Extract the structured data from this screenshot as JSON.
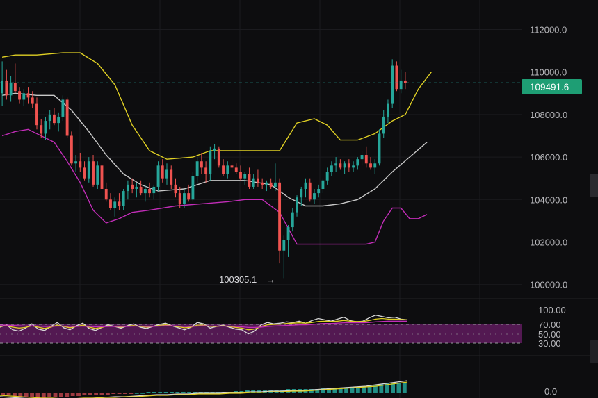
{
  "chart_data": [
    {
      "type": "line",
      "panel": "price",
      "subtype": "candlestick with Bollinger Bands",
      "y_ticks": [
        "112000.0",
        "110000.0",
        "108000.0",
        "106000.0",
        "104000.0",
        "102000.0",
        "100000.0"
      ],
      "ylim": [
        99500,
        112800
      ],
      "last_price": "109491.6",
      "low_annotation": "100305.1",
      "low_arrow": "→",
      "grid": true,
      "colors": {
        "up": "#26a69a",
        "down": "#ef5350",
        "upper_band": "#e0d024",
        "middle_band": "#c8c8c8",
        "lower_band": "#c22db8",
        "price_line": "#26a69a",
        "price_tag": "#1e9e74"
      },
      "candles": [
        [
          109000,
          110500,
          108400,
          109600
        ],
        [
          109600,
          110100,
          108700,
          108900
        ],
        [
          108900,
          109800,
          108600,
          109500
        ],
        [
          109500,
          110400,
          109000,
          109100
        ],
        [
          109100,
          109300,
          108500,
          108700
        ],
        [
          108700,
          109200,
          108400,
          109000
        ],
        [
          109000,
          109300,
          108500,
          108800
        ],
        [
          108800,
          109100,
          108300,
          108500
        ],
        [
          108500,
          108800,
          107300,
          107500
        ],
        [
          107500,
          107800,
          106900,
          107100
        ],
        [
          107100,
          107900,
          106800,
          107700
        ],
        [
          107700,
          108200,
          107300,
          108000
        ],
        [
          108000,
          108300,
          107500,
          107600
        ],
        [
          107600,
          108100,
          107200,
          107900
        ],
        [
          107900,
          108900,
          107700,
          108700
        ],
        [
          108700,
          108800,
          106900,
          107000
        ],
        [
          107000,
          107200,
          105600,
          105700
        ],
        [
          105700,
          106100,
          105300,
          105800
        ],
        [
          105800,
          106200,
          105300,
          105500
        ],
        [
          105500,
          105800,
          104900,
          105000
        ],
        [
          105000,
          106000,
          104800,
          105800
        ],
        [
          105800,
          106100,
          104600,
          104700
        ],
        [
          104700,
          105800,
          104500,
          105600
        ],
        [
          105600,
          105900,
          104300,
          104500
        ],
        [
          104500,
          104800,
          103900,
          104000
        ],
        [
          104000,
          104300,
          103500,
          103600
        ],
        [
          103600,
          104100,
          103200,
          103900
        ],
        [
          103900,
          104300,
          103500,
          103700
        ],
        [
          103700,
          104500,
          103500,
          104400
        ],
        [
          104400,
          104900,
          104000,
          104700
        ],
        [
          104700,
          105000,
          104300,
          104500
        ],
        [
          104500,
          104800,
          104100,
          104600
        ],
        [
          104600,
          104900,
          104200,
          104300
        ],
        [
          104300,
          104700,
          103900,
          104500
        ],
        [
          104500,
          104800,
          104100,
          104300
        ],
        [
          104300,
          104700,
          104000,
          104600
        ],
        [
          104600,
          105800,
          104400,
          105600
        ],
        [
          105600,
          105900,
          104800,
          105000
        ],
        [
          105000,
          105700,
          104700,
          105400
        ],
        [
          105400,
          105600,
          104500,
          104700
        ],
        [
          104700,
          105000,
          104100,
          104300
        ],
        [
          104300,
          104600,
          103600,
          103800
        ],
        [
          103800,
          104500,
          103600,
          104300
        ],
        [
          104300,
          104700,
          103900,
          104000
        ],
        [
          104000,
          105300,
          103900,
          105100
        ],
        [
          105100,
          106000,
          104800,
          105800
        ],
        [
          105800,
          106200,
          105200,
          105500
        ],
        [
          105500,
          105800,
          104800,
          105200
        ],
        [
          105200,
          106500,
          104900,
          106300
        ],
        [
          106300,
          106600,
          105900,
          106400
        ],
        [
          106400,
          106500,
          105500,
          105600
        ],
        [
          105600,
          105900,
          105100,
          105200
        ],
        [
          105200,
          105800,
          105000,
          105600
        ],
        [
          105600,
          105900,
          105300,
          105500
        ],
        [
          105500,
          105700,
          105200,
          105300
        ],
        [
          105300,
          105600,
          104900,
          105000
        ],
        [
          105000,
          105300,
          104700,
          105200
        ],
        [
          105200,
          105500,
          104500,
          104600
        ],
        [
          104600,
          105200,
          104500,
          105000
        ],
        [
          105000,
          105400,
          104600,
          104800
        ],
        [
          104800,
          105000,
          104500,
          104700
        ],
        [
          104700,
          104900,
          104400,
          104800
        ],
        [
          104800,
          105000,
          104500,
          104600
        ],
        [
          104600,
          105700,
          104400,
          104800
        ],
        [
          104800,
          105000,
          101000,
          101600
        ],
        [
          101600,
          102300,
          100305,
          102100
        ],
        [
          102100,
          102800,
          101300,
          102700
        ],
        [
          102700,
          103600,
          102500,
          103400
        ],
        [
          103400,
          104200,
          103200,
          104100
        ],
        [
          104100,
          104600,
          103700,
          104500
        ],
        [
          104500,
          105000,
          104100,
          104800
        ],
        [
          104800,
          105000,
          103900,
          104000
        ],
        [
          104000,
          104500,
          103800,
          104300
        ],
        [
          104300,
          104700,
          104100,
          104500
        ],
        [
          104500,
          105000,
          104300,
          104900
        ],
        [
          104900,
          105500,
          104700,
          105300
        ],
        [
          105300,
          105800,
          105100,
          105600
        ],
        [
          105600,
          106000,
          105300,
          105700
        ],
        [
          105700,
          105900,
          105400,
          105500
        ],
        [
          105500,
          105800,
          105200,
          105700
        ],
        [
          105700,
          105900,
          105300,
          105500
        ],
        [
          105500,
          105800,
          105300,
          105600
        ],
        [
          105600,
          106000,
          105400,
          105900
        ],
        [
          105900,
          106300,
          105600,
          106100
        ],
        [
          106100,
          106500,
          105500,
          105700
        ],
        [
          105700,
          106000,
          105400,
          105500
        ],
        [
          105500,
          105900,
          105200,
          105700
        ],
        [
          105700,
          107300,
          105600,
          107100
        ],
        [
          107100,
          108200,
          106900,
          107900
        ],
        [
          107900,
          108700,
          107600,
          108500
        ],
        [
          108500,
          110600,
          108300,
          110300
        ],
        [
          110300,
          110500,
          109100,
          109200
        ],
        [
          109200,
          110100,
          109000,
          109600
        ],
        [
          109600,
          110000,
          109200,
          109491.6
        ]
      ],
      "upper_band": [
        [
          0,
          110700
        ],
        [
          3,
          110800
        ],
        [
          8,
          110800
        ],
        [
          14,
          110900
        ],
        [
          18,
          110900
        ],
        [
          22,
          110400
        ],
        [
          26,
          109400
        ],
        [
          30,
          107500
        ],
        [
          34,
          106300
        ],
        [
          38,
          105900
        ],
        [
          44,
          106000
        ],
        [
          48,
          106300
        ],
        [
          56,
          106300
        ],
        [
          64,
          106300
        ],
        [
          68,
          107600
        ],
        [
          72,
          107800
        ],
        [
          75,
          107500
        ],
        [
          78,
          106800
        ],
        [
          82,
          106800
        ],
        [
          86,
          107100
        ],
        [
          90,
          107700
        ],
        [
          93,
          108000
        ],
        [
          96,
          109200
        ],
        [
          99,
          110000
        ]
      ],
      "middle_band": [
        [
          0,
          108900
        ],
        [
          3,
          109000
        ],
        [
          8,
          108900
        ],
        [
          12,
          108900
        ],
        [
          16,
          108200
        ],
        [
          20,
          107200
        ],
        [
          24,
          106100
        ],
        [
          28,
          105200
        ],
        [
          32,
          104700
        ],
        [
          36,
          104400
        ],
        [
          42,
          104500
        ],
        [
          48,
          104900
        ],
        [
          56,
          104900
        ],
        [
          62,
          104700
        ],
        [
          66,
          104100
        ],
        [
          70,
          103700
        ],
        [
          74,
          103700
        ],
        [
          78,
          103800
        ],
        [
          82,
          104000
        ],
        [
          86,
          104500
        ],
        [
          90,
          105300
        ],
        [
          94,
          106000
        ],
        [
          98,
          106700
        ]
      ],
      "lower_band": [
        [
          0,
          107000
        ],
        [
          3,
          107200
        ],
        [
          6,
          107300
        ],
        [
          9,
          107000
        ],
        [
          12,
          106700
        ],
        [
          15,
          105800
        ],
        [
          18,
          104800
        ],
        [
          21,
          103500
        ],
        [
          24,
          102900
        ],
        [
          27,
          103100
        ],
        [
          30,
          103400
        ],
        [
          34,
          103500
        ],
        [
          40,
          103700
        ],
        [
          46,
          103800
        ],
        [
          52,
          103900
        ],
        [
          56,
          104000
        ],
        [
          60,
          104000
        ],
        [
          64,
          103400
        ],
        [
          68,
          101900
        ],
        [
          72,
          101900
        ],
        [
          76,
          101900
        ],
        [
          80,
          101900
        ],
        [
          84,
          101900
        ],
        [
          86,
          102000
        ],
        [
          88,
          103000
        ],
        [
          90,
          103600
        ],
        [
          92,
          103600
        ],
        [
          94,
          103100
        ],
        [
          96,
          103100
        ],
        [
          98,
          103300
        ]
      ]
    },
    {
      "type": "line",
      "panel": "oscillator",
      "y_ticks": [
        "100.00",
        "70.00",
        "50.00",
        "30.00"
      ],
      "ylim": [
        0,
        100
      ],
      "band_range": [
        30,
        70
      ],
      "colors": {
        "band": "#6b1e6a",
        "line_white": "#d8d8d8",
        "line_yellow": "#e0d024",
        "line_magenta": "#c22db8"
      },
      "series": [
        {
          "values": [
            48,
            55,
            40,
            36,
            45,
            58,
            42,
            38,
            50,
            62,
            46,
            40,
            52,
            60,
            44,
            38,
            47,
            55,
            50,
            45,
            52,
            58,
            48,
            44,
            50,
            56,
            60,
            52,
            46,
            40,
            48,
            62,
            58,
            45,
            50,
            54,
            48,
            42,
            40,
            28,
            36,
            55,
            62,
            58,
            60,
            64,
            62,
            66,
            60,
            68,
            74,
            70,
            66,
            72,
            78,
            68,
            64,
            66,
            76,
            84,
            80,
            76,
            78,
            72,
            70
          ]
        },
        {
          "values": [
            50,
            52,
            48,
            45,
            47,
            52,
            48,
            44,
            48,
            54,
            50,
            46,
            50,
            54,
            48,
            44,
            47,
            52,
            50,
            48,
            51,
            53,
            50,
            48,
            50,
            53,
            55,
            52,
            49,
            46,
            48,
            54,
            54,
            50,
            50,
            52,
            50,
            47,
            45,
            40,
            42,
            50,
            55,
            56,
            57,
            59,
            60,
            61,
            60,
            62,
            65,
            66,
            65,
            66,
            68,
            66,
            65,
            65,
            68,
            72,
            74,
            72,
            72,
            71,
            70
          ]
        },
        {
          "values": [
            54,
            54,
            53,
            52,
            51,
            52,
            51,
            50,
            50,
            51,
            51,
            50,
            50,
            51,
            50,
            49,
            49,
            50,
            50,
            50,
            50,
            51,
            51,
            50,
            50,
            51,
            52,
            52,
            51,
            50,
            50,
            51,
            52,
            51,
            51,
            51,
            51,
            50,
            49,
            47,
            47,
            48,
            50,
            51,
            52,
            53,
            54,
            55,
            55,
            56,
            58,
            59,
            59,
            60,
            61,
            61,
            61,
            61,
            62,
            64,
            65,
            66,
            66,
            66,
            66
          ]
        }
      ]
    },
    {
      "type": "bar",
      "panel": "macd",
      "y_ticks": [
        "0.0"
      ],
      "colors": {
        "positive": "#26a69a",
        "signal": "#e0d024",
        "macd": "#d8d8d8"
      },
      "histogram": [
        -2,
        -3,
        -4,
        -5,
        -6,
        -6,
        -7,
        -7,
        -6,
        -6,
        -5,
        -5,
        -4,
        -4,
        -3,
        -3,
        -2,
        -2,
        -2,
        -1,
        -1,
        -1,
        -1,
        0,
        0,
        1,
        1,
        1,
        2,
        2,
        2,
        2,
        1,
        1,
        1,
        1,
        2,
        2,
        2,
        2,
        3,
        3,
        4,
        4,
        4,
        4,
        5,
        5,
        5,
        6,
        6,
        6,
        6,
        6,
        6,
        7,
        7,
        7,
        8,
        8,
        9,
        9,
        10,
        11,
        12,
        13,
        14,
        15,
        14,
        14
      ],
      "series": [
        {
          "values": [
            -5,
            -6,
            -7,
            -8,
            -9,
            -9,
            -9,
            -8,
            -8,
            -7,
            -6,
            -5,
            -5,
            -4,
            -3,
            -2,
            -2,
            -1,
            -1,
            0,
            0,
            0,
            1,
            1,
            2,
            2,
            3,
            3,
            4,
            4,
            5,
            6,
            7,
            8,
            9,
            10,
            12,
            14,
            16,
            18
          ]
        },
        {
          "values": [
            -3,
            -4,
            -5,
            -6,
            -7,
            -7,
            -8,
            -8,
            -7,
            -7,
            -6,
            -6,
            -5,
            -5,
            -4,
            -3,
            -3,
            -2,
            -2,
            -1,
            -1,
            -1,
            0,
            0,
            1,
            1,
            2,
            2,
            3,
            3,
            4,
            5,
            6,
            7,
            8,
            9,
            10,
            12,
            14,
            16
          ]
        }
      ]
    }
  ]
}
